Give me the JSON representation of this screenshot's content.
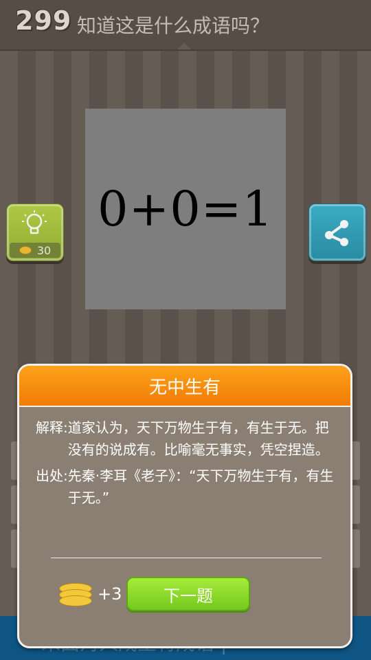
{
  "header": {
    "level": "299",
    "question": "知道这是什么成语吗？"
  },
  "puzzle": {
    "equation": "0+0=1"
  },
  "hint_button": {
    "icon": "lightbulb-icon",
    "cost": "30",
    "color": "#a8c63f"
  },
  "share_button": {
    "icon": "share-icon",
    "color": "#35a5bf"
  },
  "banner": {
    "ticker": "未面对人成主将成语    |  一   "
  },
  "modal": {
    "title": "无中生有",
    "explanation_label": "解释:",
    "explanation_text": "道家认为，天下万物生于有，有生于无。把没有的说成有。比喻毫无事实，凭空捏造。",
    "source_label": "出处:",
    "source_text": "先秦·李耳《老子》：“天下万物生于有，有生于无。”",
    "reward": "+3",
    "next_label": "下一题"
  },
  "colors": {
    "header_orange": "#f48a0c",
    "next_green": "#8cd92a",
    "modal_bg": "#8a7f72"
  }
}
